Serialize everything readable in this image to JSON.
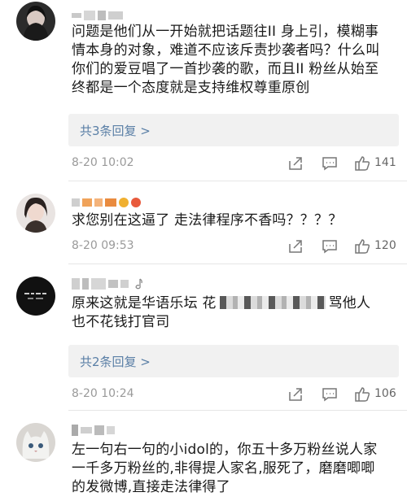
{
  "comments": [
    {
      "text_lines": [
        "问题是他们从一开始就把话题往II 身上引，模糊事",
        "情本身的对象，难道不应该斥责抄袭者吗？什么叫",
        "你们的爱豆唱了一首抄袭的歌，而且II 粉丝从始至",
        "终都是一个态度就是支持维权尊重原创"
      ],
      "replies": "共3条回复 >",
      "time": "8-20 10:02",
      "likes": "141"
    },
    {
      "text_lines": [
        "求您别在这逼了 走法律程序不香吗？？？？"
      ],
      "time": "8-20 09:53",
      "likes": "120"
    },
    {
      "text_before": "原来这就是华语乐坛 花",
      "text_after": "骂他人",
      "text_line2": "也不花钱打官司",
      "replies": "共2条回复 >",
      "time": "8-20 10:24",
      "likes": "106"
    },
    {
      "text_lines": [
        "左一句右一句的小idol的，你五十多万粉丝说人家",
        "一千多万粉丝的,非得提人家名,服死了，磨磨唧唧",
        "的发微博,直接走法律得了"
      ]
    }
  ],
  "colors": {
    "reply_link": "#5a7fa6",
    "meta": "#9a9a9a",
    "divider": "#e6e6e6"
  },
  "icons": [
    "share-icon",
    "comment-icon",
    "like-icon"
  ]
}
